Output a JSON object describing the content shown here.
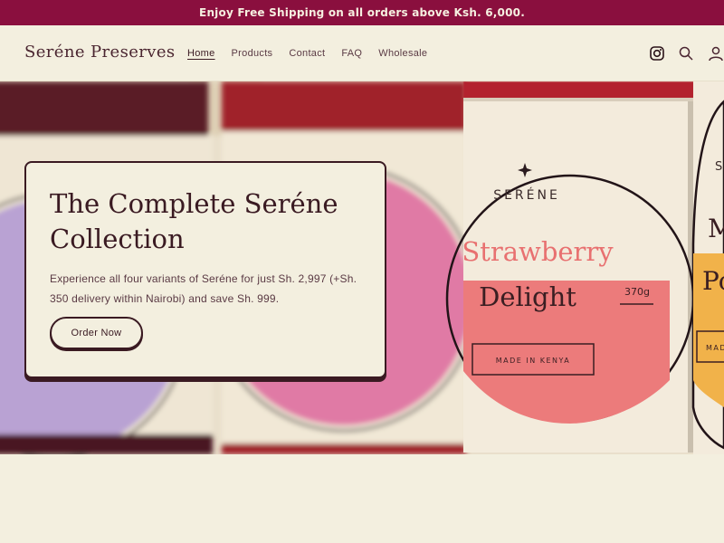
{
  "announcement": "Enjoy Free Shipping on all orders above Ksh. 6,000.",
  "header": {
    "brand": "Seréne Preserves",
    "nav": [
      "Home",
      "Products",
      "Contact",
      "FAQ",
      "Wholesale"
    ]
  },
  "hero": {
    "jar_labels": {
      "brand": "SERÉNE",
      "flavor_line1": "Strawberry",
      "flavor_line2": "Delight",
      "weight": "370g",
      "origin": "MADE IN KENYA",
      "right_brand": "S",
      "right_line1": "M",
      "right_line2": "Po",
      "right_origin": "MAD"
    },
    "card": {
      "title": "The Complete Seréne Collection",
      "description": "Experience all four variants of Seréne for just Sh. 2,997 (+Sh. 350 delivery within Nairobi) and save Sh. 999.",
      "cta": "Order Now"
    }
  },
  "colors": {
    "announcement_bg": "#8a0f3e",
    "page_bg": "#f3efdf",
    "ink": "#3a1a22"
  }
}
